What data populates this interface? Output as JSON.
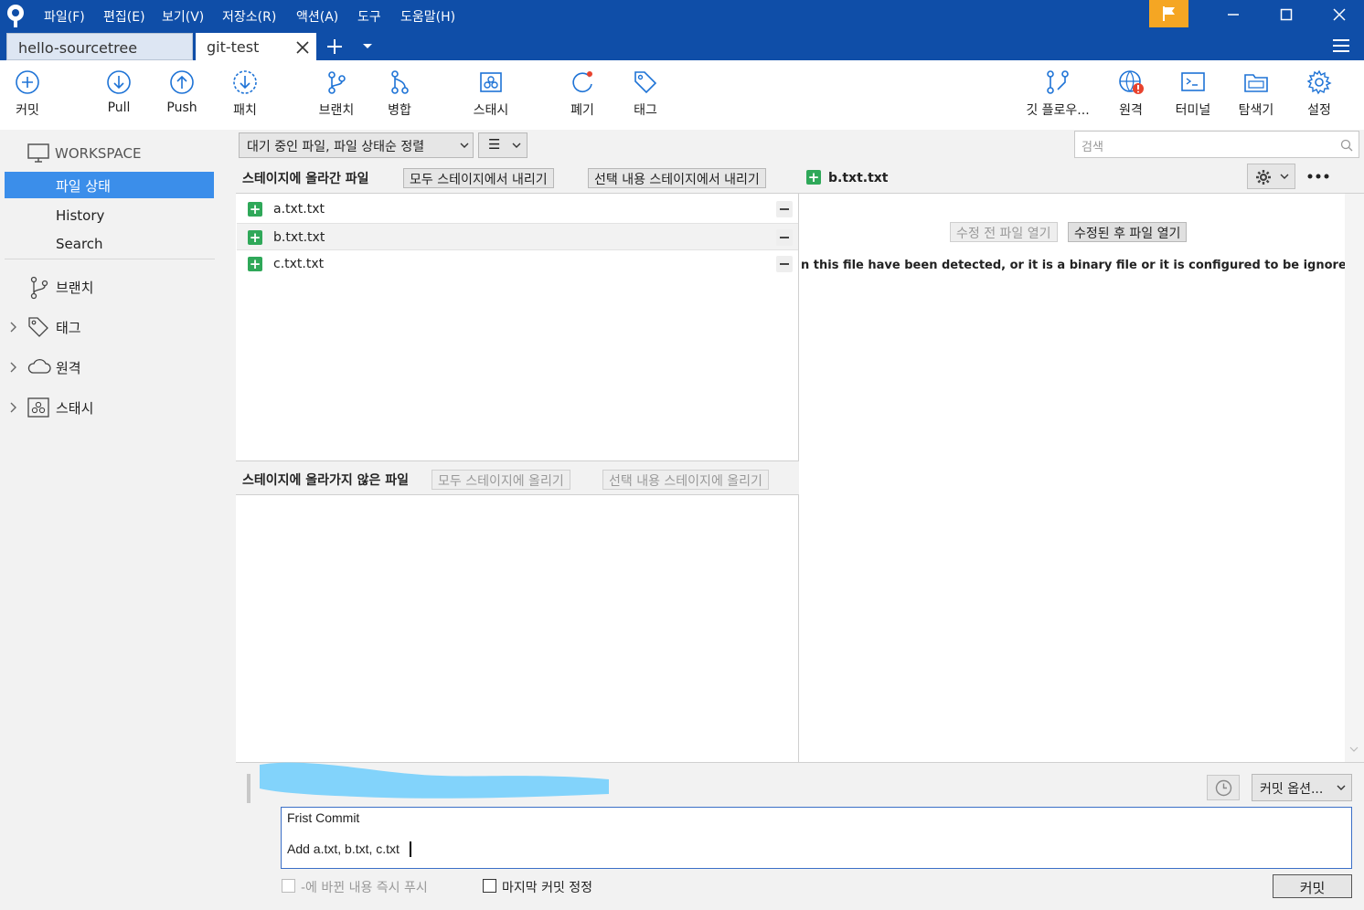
{
  "menu": [
    "파일(F)",
    "편집(E)",
    "보기(V)",
    "저장소(R)",
    "액션(A)",
    "도구",
    "도움말(H)"
  ],
  "tabs": [
    {
      "label": "hello-sourcetree"
    },
    {
      "label": "git-test"
    }
  ],
  "toolbar": {
    "commit": "커밋",
    "pull": "Pull",
    "push": "Push",
    "patch": "패치",
    "branch": "브랜치",
    "merge": "병합",
    "stash": "스태시",
    "discard": "폐기",
    "tag": "태그",
    "gitflow": "깃 플로우...",
    "remote": "원격",
    "terminal": "터미널",
    "explorer": "탐색기",
    "settings": "설정"
  },
  "sidebar": {
    "workspace": "WORKSPACE",
    "file_status": "파일 상태",
    "history": "History",
    "search": "Search",
    "branches": "브랜치",
    "tags": "태그",
    "remotes": "원격",
    "stashes": "스태시"
  },
  "filter": {
    "sort_label": "대기 중인 파일, 파일 상태순 정렬",
    "view_icon": "☰",
    "search_placeholder": "검색"
  },
  "staged": {
    "title": "스테이지에 올라간 파일",
    "unstage_all": "모두 스테이지에서 내리기",
    "unstage_selected": "선택 내용 스테이지에서 내리기",
    "files": [
      "a.txt.txt",
      "b.txt.txt",
      "c.txt.txt"
    ]
  },
  "unstaged": {
    "title": "스테이지에 올라가지 않은 파일",
    "stage_all": "모두 스테이지에 올리기",
    "stage_selected": "선택 내용 스테이지에 올리기"
  },
  "diff": {
    "file": "b.txt.txt",
    "open_before": "수정 전 파일 열기",
    "open_after": "수정된 후 파일 열기",
    "message": "n this file have been detected, or it is a binary file or it is configured to be ignored by the"
  },
  "commit": {
    "options": "커밋 옵션...",
    "line1": "Frist Commit",
    "line2": "Add a.txt, b.txt, c.txt",
    "push_now": "-에 바뀐 내용 즉시 푸시",
    "amend": "마지막 커밋 정정",
    "button": "커밋"
  },
  "colors": {
    "titlebar": "#0f4ea8",
    "selection": "#3b8eea",
    "flag": "#f5a623",
    "added": "#2fa859"
  }
}
